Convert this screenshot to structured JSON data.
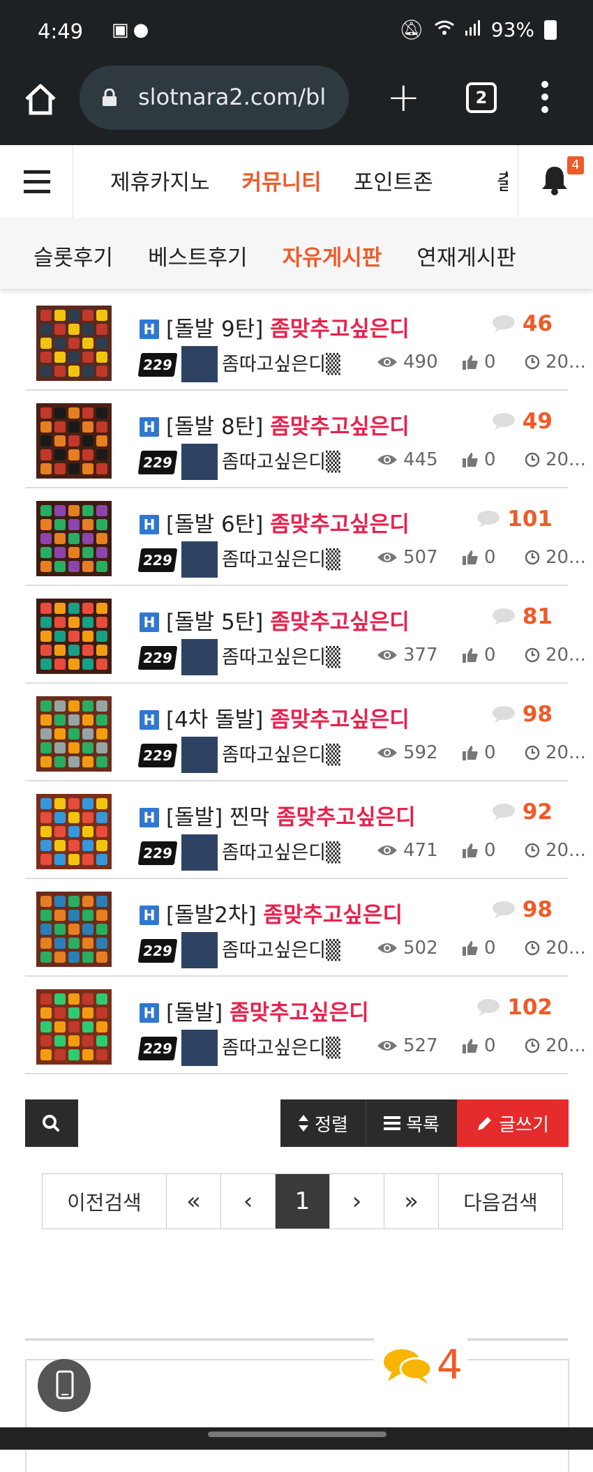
{
  "status_bar": {
    "time": "4:49",
    "battery": "93%",
    "icons_left": [
      "image-icon",
      "chat-icon"
    ],
    "icons_right": [
      "mute-icon",
      "wifi-icon",
      "signal-icon",
      "battery-icon"
    ]
  },
  "browser": {
    "url": "slotnara2.com/bl",
    "tab_count": "2"
  },
  "nav": {
    "items": [
      "제휴카지노",
      "커뮤니티",
      "포인트존"
    ],
    "active_index": 1,
    "cut_item": "출",
    "notification_count": "4"
  },
  "subnav": {
    "items": [
      "슬롯후기",
      "베스트후기",
      "자유게시판",
      "연재게시판"
    ],
    "active_index": 2
  },
  "posts": [
    {
      "prefix": "[돌발 9탄]",
      "title": "좀맞추고싶은디",
      "comments": "46",
      "level": "229",
      "author": "좀따고싶은디▒",
      "views": "490",
      "likes": "0",
      "date": "20..."
    },
    {
      "prefix": "[돌발 8탄]",
      "title": "좀맞추고싶은디",
      "comments": "49",
      "level": "229",
      "author": "좀따고싶은디▒",
      "views": "445",
      "likes": "0",
      "date": "20..."
    },
    {
      "prefix": "[돌발 6탄]",
      "title": "좀맞추고싶은디",
      "comments": "101",
      "level": "229",
      "author": "좀따고싶은디▒",
      "views": "507",
      "likes": "0",
      "date": "20..."
    },
    {
      "prefix": "[돌발 5탄]",
      "title": "좀맞추고싶은디",
      "comments": "81",
      "level": "229",
      "author": "좀따고싶은디▒",
      "views": "377",
      "likes": "0",
      "date": "20..."
    },
    {
      "prefix": "[4차 돌발]",
      "title": "좀맞추고싶은디",
      "comments": "98",
      "level": "229",
      "author": "좀따고싶은디▒",
      "views": "592",
      "likes": "0",
      "date": "20..."
    },
    {
      "prefix": "[돌발] 찐막",
      "title": "좀맞추고싶은디",
      "comments": "92",
      "level": "229",
      "author": "좀따고싶은디▒",
      "views": "471",
      "likes": "0",
      "date": "20..."
    },
    {
      "prefix": "[돌발2차]",
      "title": "좀맞추고싶은디",
      "comments": "98",
      "level": "229",
      "author": "좀따고싶은디▒",
      "views": "502",
      "likes": "0",
      "date": "20..."
    },
    {
      "prefix": "[돌발]",
      "title": "좀맞추고싶은디",
      "comments": "102",
      "level": "229",
      "author": "좀따고싶은디▒",
      "views": "527",
      "likes": "0",
      "date": "20..."
    }
  ],
  "post_badge": "H",
  "toolbar": {
    "sort_label": "정렬",
    "list_label": "목록",
    "write_label": "글쓰기"
  },
  "pagination": {
    "prev_search": "이전검색",
    "first": "«",
    "prev": "‹",
    "current": "1",
    "next": "›",
    "last": "»",
    "next_search": "다음검색"
  },
  "chat_widget": {
    "count": "4"
  },
  "colors": {
    "accent": "#f05a28",
    "title_red": "#e8214d",
    "write_button": "#e52b2b",
    "badge_blue": "#2f77d0",
    "dark_bar": "#1e2124"
  }
}
